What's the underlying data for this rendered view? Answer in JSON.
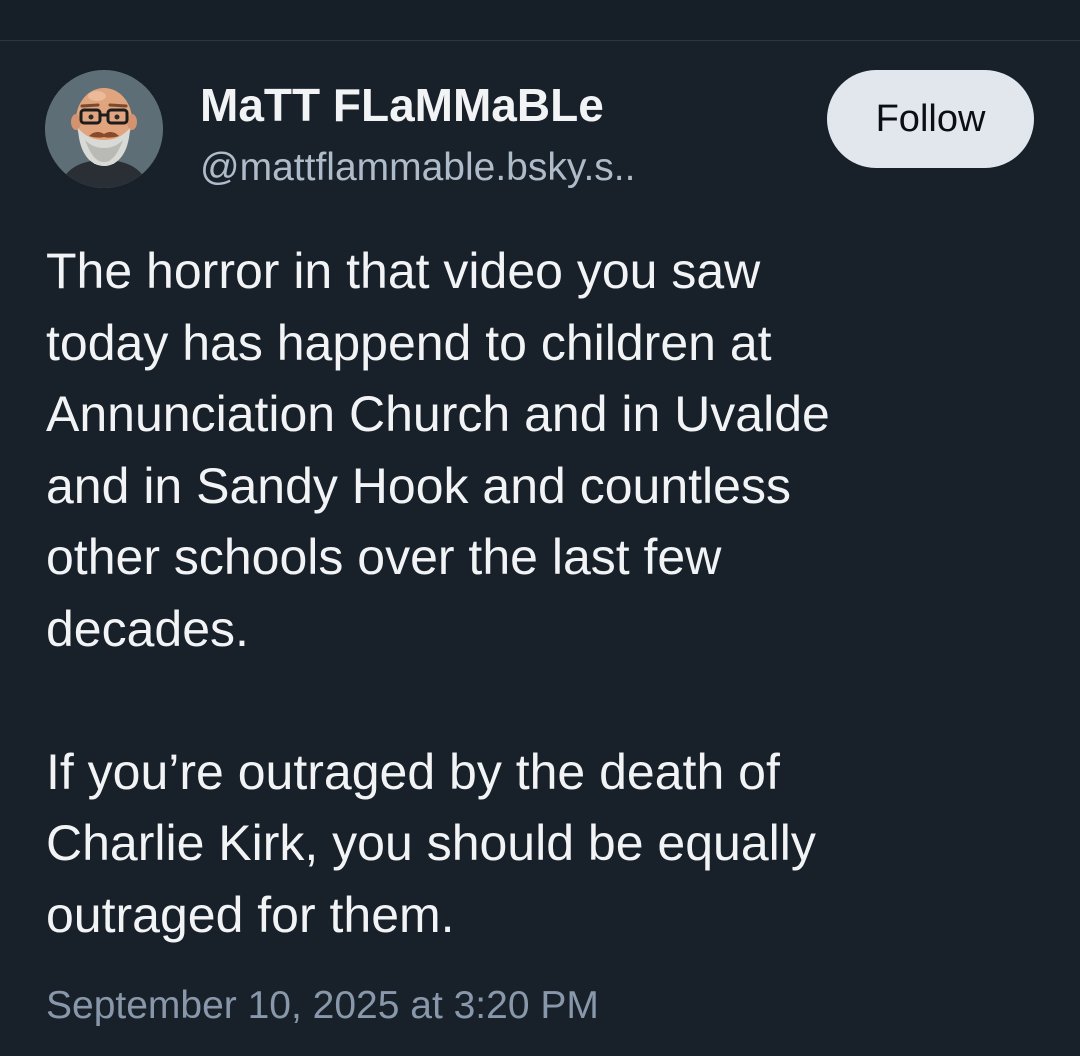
{
  "post": {
    "author": {
      "display_name": "MaTT FLaMMaBLe",
      "handle": "@mattflammable.bsky.s..",
      "avatar_icon": "avatar-cartoon-bearded-man-glasses"
    },
    "follow_label": "Follow",
    "paragraphs": [
      "The horror in that video you saw\ntoday has happend to children at\nAnnunciation Church and in Uvalde\nand in Sandy Hook and countless\nother schools over the last few\ndecades.",
      "If you’re outraged by the death of\nCharlie Kirk, you should be equally\noutraged for them."
    ],
    "timestamp": "September 10, 2025 at 3:20 PM"
  },
  "colors": {
    "background": "#161e27",
    "text": "#f1f3f5",
    "handle": "#aebbc9",
    "timestamp": "#8898aa",
    "follow_button_bg": "#e2e7ee"
  }
}
